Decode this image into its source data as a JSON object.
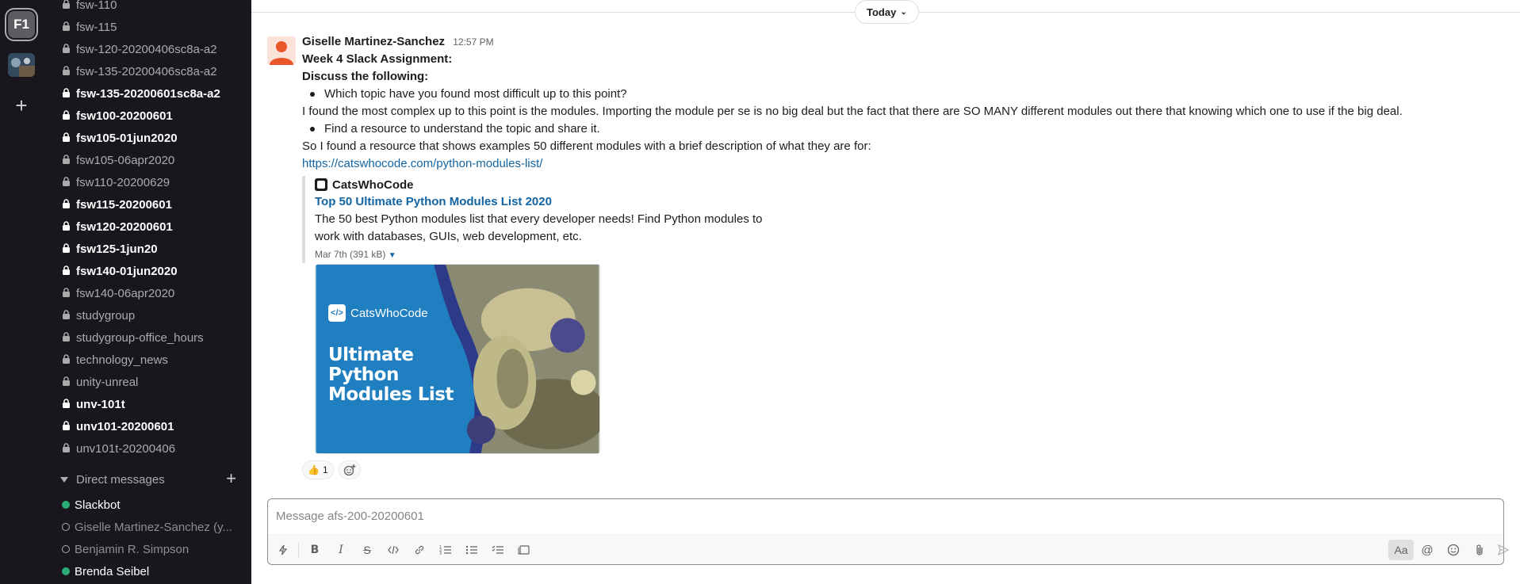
{
  "workspace": {
    "badge": "F1",
    "add_symbol": "+"
  },
  "sidebar": {
    "channels": [
      {
        "name": "fsw-110",
        "bold": false
      },
      {
        "name": "fsw-115",
        "bold": false
      },
      {
        "name": "fsw-120-20200406sc8a-a2",
        "bold": false
      },
      {
        "name": "fsw-135-20200406sc8a-a2",
        "bold": false
      },
      {
        "name": "fsw-135-20200601sc8a-a2",
        "bold": true
      },
      {
        "name": "fsw100-20200601",
        "bold": true
      },
      {
        "name": "fsw105-01jun2020",
        "bold": true
      },
      {
        "name": "fsw105-06apr2020",
        "bold": false
      },
      {
        "name": "fsw110-20200629",
        "bold": false
      },
      {
        "name": "fsw115-20200601",
        "bold": true
      },
      {
        "name": "fsw120-20200601",
        "bold": true
      },
      {
        "name": "fsw125-1jun20",
        "bold": true
      },
      {
        "name": "fsw140-01jun2020",
        "bold": true
      },
      {
        "name": "fsw140-06apr2020",
        "bold": false
      },
      {
        "name": "studygroup",
        "bold": false
      },
      {
        "name": "studygroup-office_hours",
        "bold": false
      },
      {
        "name": "technology_news",
        "bold": false
      },
      {
        "name": "unity-unreal",
        "bold": false
      },
      {
        "name": "unv-101t",
        "bold": true
      },
      {
        "name": "unv101-20200601",
        "bold": true
      },
      {
        "name": "unv101t-20200406",
        "bold": false
      }
    ],
    "dm_section": {
      "label": "Direct messages",
      "add_symbol": "+"
    },
    "dms": [
      {
        "name": "Slackbot",
        "status": "online"
      },
      {
        "name": "Giselle Martinez-Sanchez  (y...",
        "status": "away"
      },
      {
        "name": "Benjamin R. Simpson",
        "status": "away"
      },
      {
        "name": "Brenda Seibel",
        "status": "online"
      }
    ]
  },
  "main": {
    "day_divider": "Today",
    "message": {
      "sender": "Giselle Martinez-Sanchez",
      "time": "12:57 PM",
      "lines": {
        "l1": "Week 4 Slack Assignment:",
        "l2": "Discuss the following:",
        "b1": "Which topic have you found most difficult up to this point?",
        "l3": "I found the most complex up to this point is the modules. Importing the module per se is no big deal but the fact that there are SO MANY different modules out there that knowing which one to use if the big deal.",
        "b2": "Find a resource to understand the topic and share it.",
        "l4": "So I found a resource that shows examples 50 different modules with a brief description of what they are for:",
        "link": "https://catswhocode.com/python-modules-list/"
      },
      "unfurl": {
        "source": "CatsWhoCode",
        "title": "Top 50 Ultimate Python Modules List 2020",
        "description": "The 50 best Python modules list that every developer needs! Find Python modules to work with databases, GUIs, web development, etc.",
        "meta": "Mar 7th (391 kB)",
        "image_brand": "CatsWhoCode",
        "image_logo": "</>",
        "image_headline": "Ultimate Python Modules List"
      },
      "reactions": [
        {
          "emoji": "👍",
          "count": "1"
        }
      ]
    },
    "composer": {
      "placeholder": "Message afs-200-20200601",
      "tool_labels": {
        "bold": "B",
        "italic": "I",
        "strike": "S",
        "format": "Aa"
      }
    }
  },
  "colors": {
    "sidebar_bg": "#19171d",
    "link": "#1264a3",
    "online": "#2bac76",
    "preview_blue": "#1f7fc0"
  }
}
